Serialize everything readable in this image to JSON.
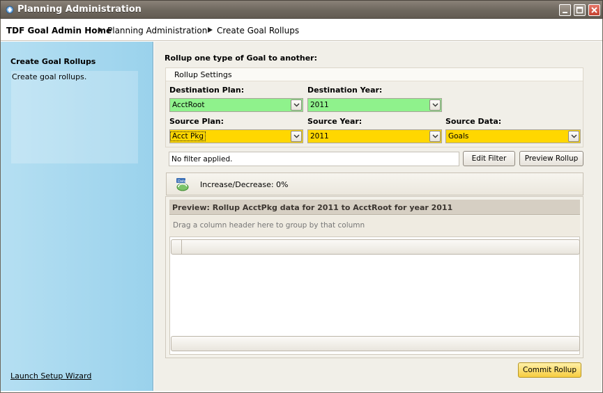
{
  "window": {
    "title": "Planning Administration"
  },
  "breadcrumb": {
    "items": [
      "TDF Goal Admin Home",
      "Planning Administration",
      "Create Goal Rollups"
    ]
  },
  "sidebar": {
    "title": "Create Goal Rollups",
    "description": "Create goal rollups.",
    "wizard_link": "Launch Setup Wizard"
  },
  "main": {
    "heading": "Rollup one type of Goal to another:",
    "settings_title": "Rollup Settings",
    "destination_plan": {
      "label": "Destination Plan:",
      "value": "AcctRoot"
    },
    "destination_year": {
      "label": "Destination Year:",
      "value": "2011"
    },
    "source_plan": {
      "label": "Source Plan:",
      "value": "Acct Pkg"
    },
    "source_year": {
      "label": "Source Year:",
      "value": "2011"
    },
    "source_data": {
      "label": "Source Data:",
      "value": "Goals"
    },
    "filter_text": "No filter applied.",
    "edit_filter_label": "Edit Filter",
    "preview_rollup_label": "Preview Rollup",
    "increase_decrease": "Increase/Decrease: 0%",
    "grid": {
      "title": "Preview: Rollup AcctPkg data for 2011 to AcctRoot for year 2011",
      "group_hint": "Drag a column header here to group by that column"
    },
    "commit_label": "Commit Rollup"
  },
  "colors": {
    "green_field": "#8ff28c",
    "yellow_field": "#ffd700",
    "sidebar": "#a9d9ef"
  }
}
